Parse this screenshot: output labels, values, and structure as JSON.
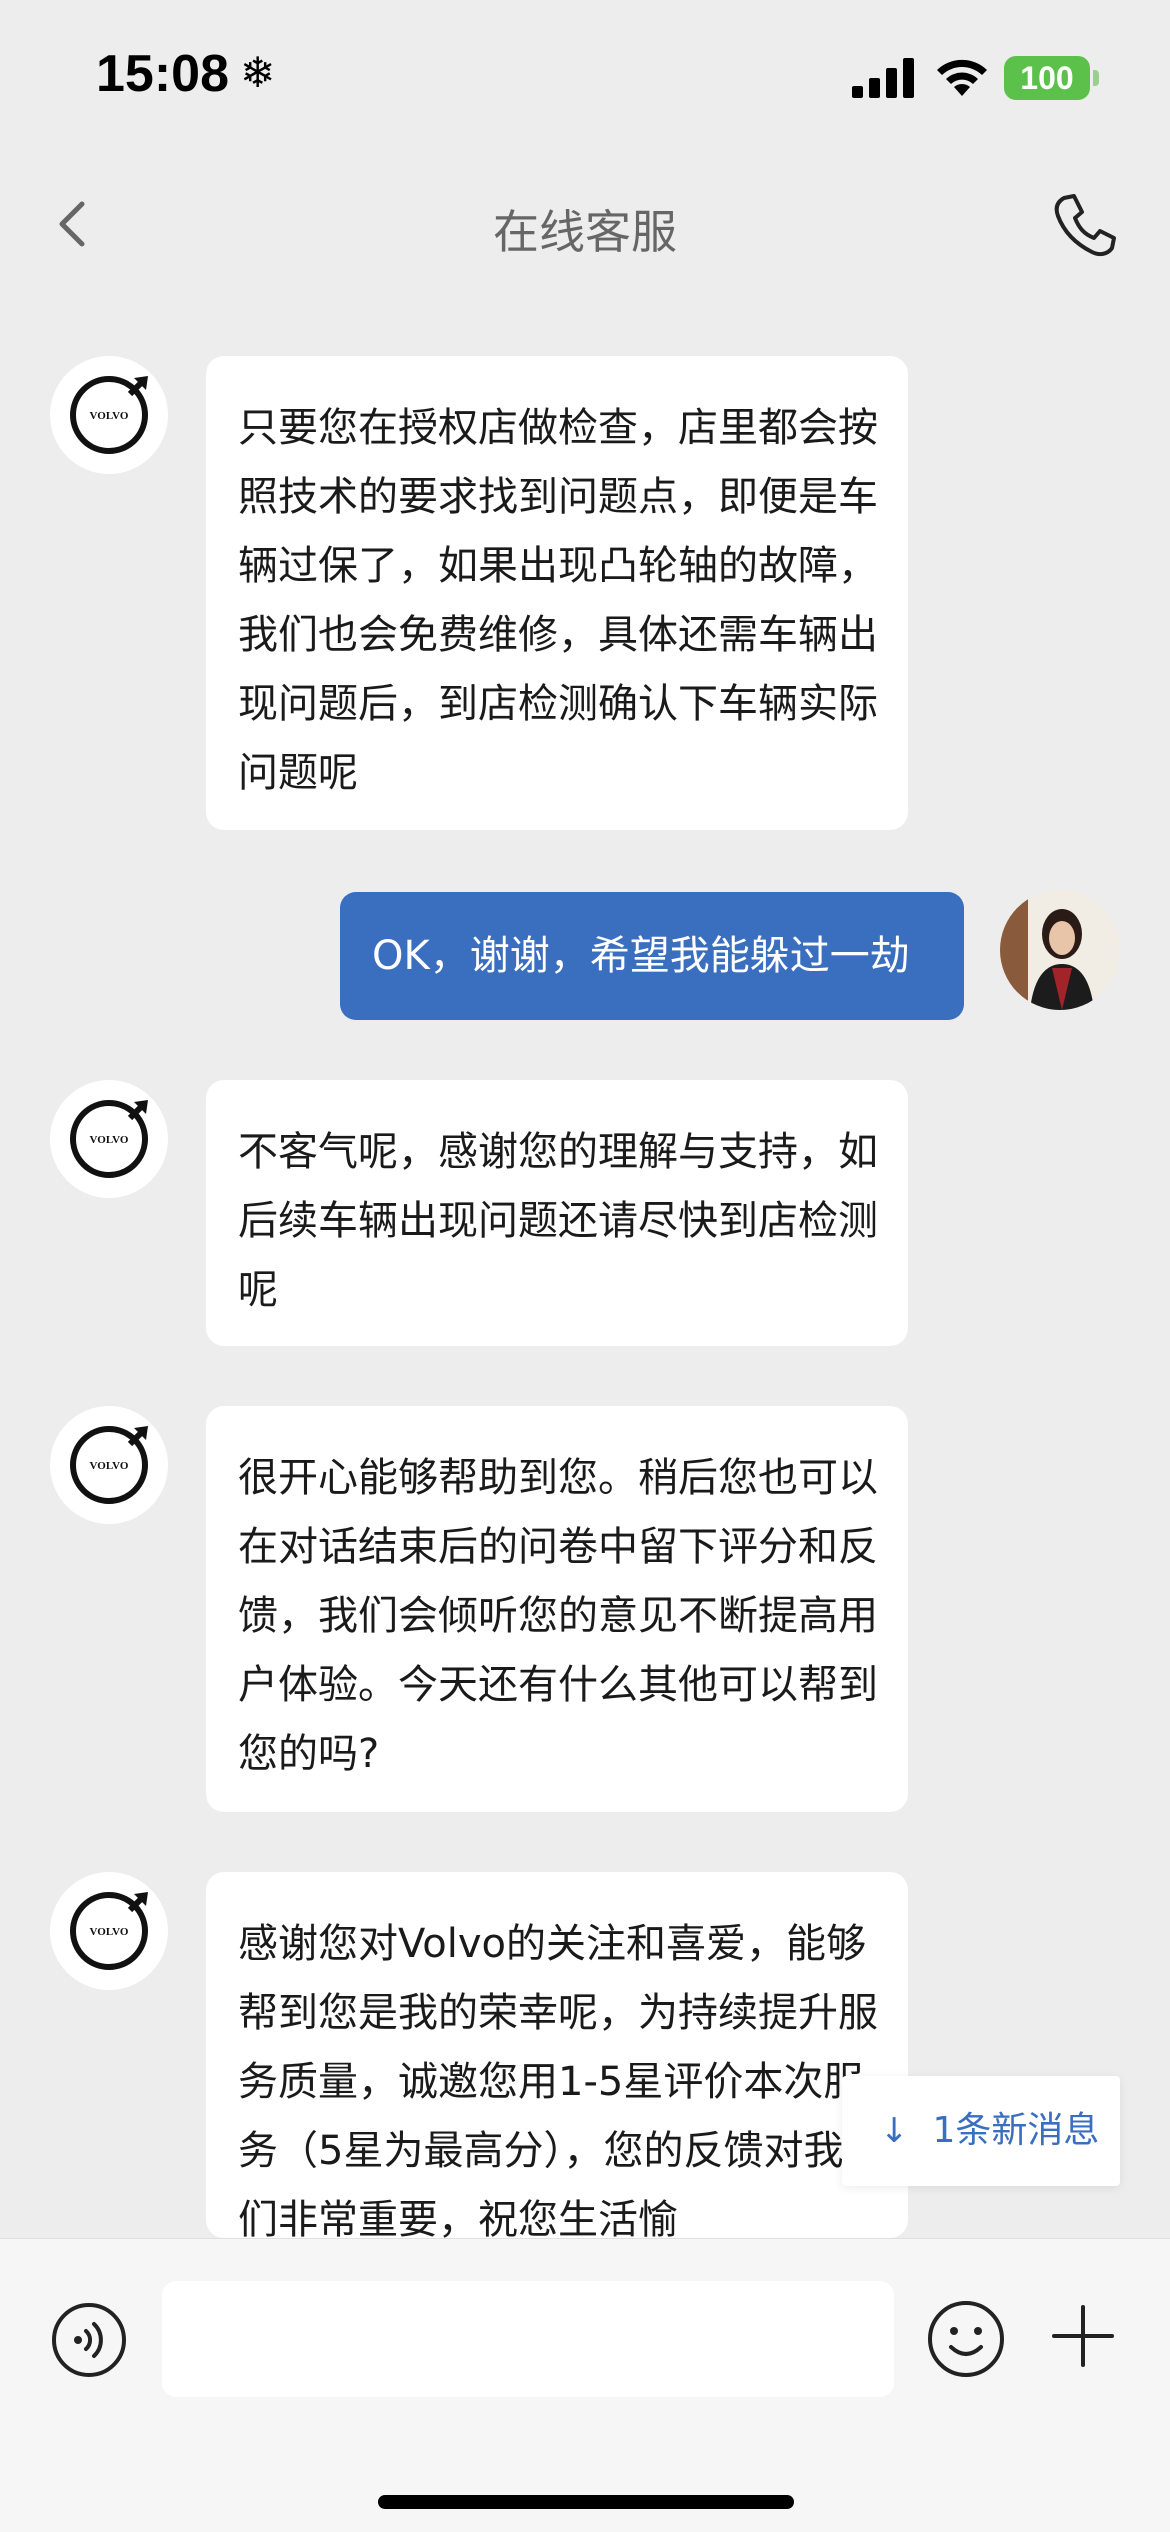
{
  "status_bar": {
    "time": "15:08",
    "snow_glyph": "❄",
    "battery": "100",
    "battery_color": "#5cc14a"
  },
  "nav": {
    "title": "在线客服"
  },
  "messages": [
    {
      "sender": "bot",
      "text": "只要您在授权店做检查，店里都会按照技术的要求找到问题点，即便是车辆过保了，如果出现凸轮轴的故障，我们也会免费维修，具体还需车辆出现问题后，到店检测确认下车辆实际问题呢"
    },
    {
      "sender": "user",
      "text": "OK，谢谢，希望我能躲过一劫"
    },
    {
      "sender": "bot",
      "text": "不客气呢，感谢您的理解与支持，如后续车辆出现问题还请尽快到店检测呢"
    },
    {
      "sender": "bot",
      "text": "很开心能够帮助到您。稍后您也可以在对话结束后的问卷中留下评分和反馈，我们会倾听您的意见不断提高用户体验。今天还有什么其他可以帮到您的吗?"
    },
    {
      "sender": "bot",
      "text": "感谢您对Volvo的关注和喜爱，能够帮到您是我的荣幸呢，为持续提升服务质量，诚邀您用1-5星评价本次服务（5星为最高分），您的反馈对我们非常重要，祝您生活愉"
    }
  ],
  "bot_logo_text": "VOLVO",
  "new_message_badge": "1条新消息",
  "new_message_arrow": "↓",
  "colors": {
    "accent": "#3a6ebf",
    "background": "#ededed"
  },
  "icons": [
    "back-arrow",
    "phone",
    "voice",
    "emoji",
    "plus"
  ]
}
